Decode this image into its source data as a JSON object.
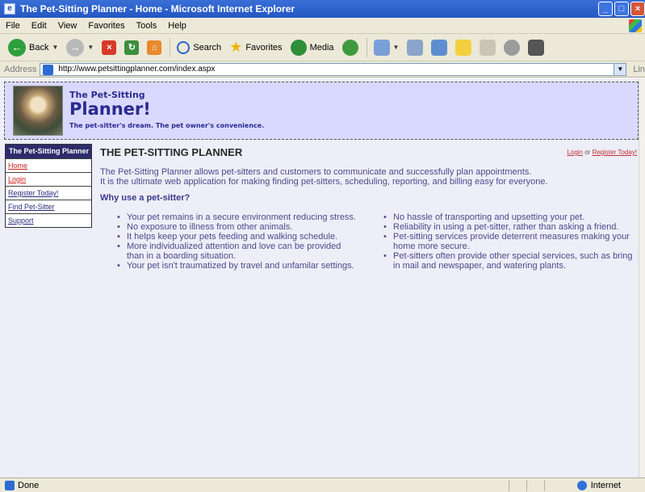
{
  "window": {
    "title": "The Pet-Sitting Planner - Home - Microsoft Internet Explorer",
    "min": "_",
    "max": "□",
    "close": "×"
  },
  "menu": [
    "File",
    "Edit",
    "View",
    "Favorites",
    "Tools",
    "Help"
  ],
  "toolbar": {
    "back": "Back",
    "search": "Search",
    "favorites": "Favorites",
    "media": "Media"
  },
  "address": {
    "label": "Address",
    "url": "http://www.petsittingplanner.com/index.aspx",
    "links": "Lin"
  },
  "site": {
    "title_small": "The Pet-Sitting",
    "title_big": "Planner!",
    "tagline": "The pet-sitter's dream. The pet owner's convenience."
  },
  "sidebar": {
    "heading": "The Pet-Sitting Planner",
    "items": [
      {
        "label": "Home"
      },
      {
        "label": "Login"
      },
      {
        "label": "Register Today!"
      },
      {
        "label": "Find Pet-Sitter"
      },
      {
        "label": "Support"
      }
    ]
  },
  "main": {
    "heading": "THE PET-SITTING PLANNER",
    "login": "Login",
    "or": " or ",
    "register": "Register Today!",
    "intro1": "The Pet-Sitting Planner allows pet-sitters and customers to communicate and successfully plan appointments.",
    "intro2": "It is the ultimate web application for making finding pet-sitters, scheduling, reporting, and billing easy for everyone.",
    "why": "Why use a pet-sitter?",
    "left_bullets": [
      "Your pet remains in a secure environment reducing stress.",
      "No exposure to illness from other animals.",
      "It helps keep your pets feeding and walking schedule.",
      "More individualized attention and love can be provided than in a boarding situation.",
      "Your pet isn't traumatized by travel and unfamilar settings."
    ],
    "right_bullets": [
      "No hassle of transporting and upsetting your pet.",
      "Reliability in using a pet-sitter, rather than asking a friend.",
      "Pet-sitting services provide deterrent measures making your home more secure.",
      "Pet-sitters often provide other special services, such as bring in mail and newspaper, and watering plants."
    ]
  },
  "status": {
    "text": "Done",
    "zone": "Internet"
  }
}
